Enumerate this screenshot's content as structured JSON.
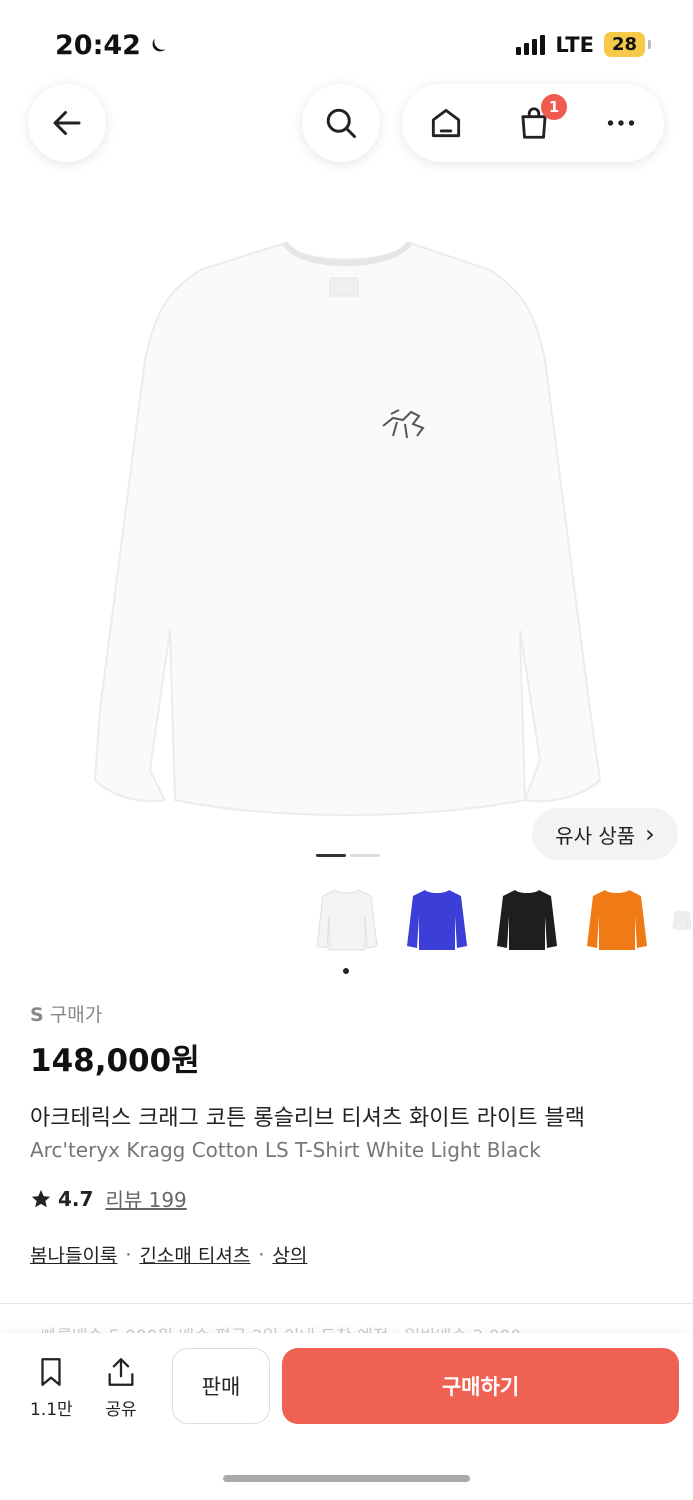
{
  "status_bar": {
    "time": "20:42",
    "network": "LTE",
    "battery": "28"
  },
  "nav": {
    "cart_badge": "1"
  },
  "hero": {
    "similar_label": "유사 상품",
    "similar_chevron": "›"
  },
  "gallery": {
    "thumb_colors": [
      "#f4f4f4",
      "#3b3fd8",
      "#1e1e1e",
      "#f07b15",
      "#eeeeee"
    ]
  },
  "product": {
    "size": "S",
    "size_suffix": "구매가",
    "price": "148,000원",
    "name_ko": "아크테릭스 크래그 코튼 롱슬리브 티셔츠 화이트 라이트 블랙",
    "name_en": "Arc'teryx Kragg Cotton LS T-Shirt White Light Black",
    "rating": "4.7",
    "reviews_label": "리뷰 199",
    "categories": [
      "봄나들이룩",
      "긴소매 티셔츠",
      "상의"
    ],
    "category_sep": "·"
  },
  "faded_text": "· 빠른배송 5,000원 배송 평균 2일 이내 도착 예정 · 일반배송 3,000",
  "bottom_bar": {
    "wishlist_count": "1.1만",
    "share_label": "공유",
    "sell_label": "판매",
    "buy_label": "구매하기"
  },
  "colors": {
    "accent": "#ef6253",
    "badge": "#ef5b4f"
  }
}
